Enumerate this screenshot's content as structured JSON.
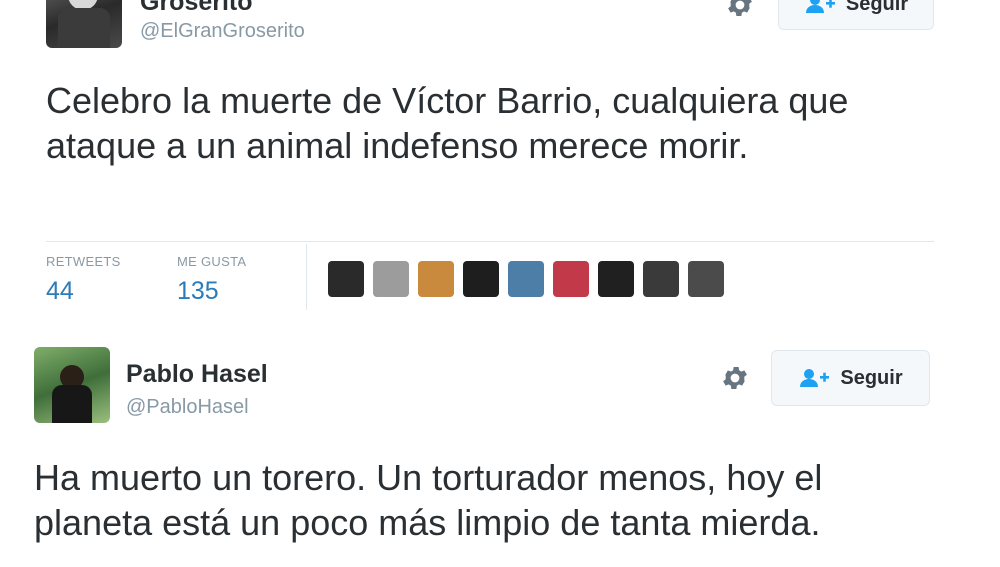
{
  "tweet1": {
    "name": "Groserito",
    "handle": "@ElGranGroserito",
    "follow_label": "Seguir",
    "text": "Celebro la muerte de Víctor Barrio, cualquiera que ataque a un animal indefenso merece morir.",
    "retweets_label": "RETWEETS",
    "retweets_count": "44",
    "likes_label": "ME GUSTA",
    "likes_count": "135",
    "liker_colors": [
      "#2a2a2a",
      "#9c9c9c",
      "#c98a3d",
      "#1e1e1e",
      "#4d7ea8",
      "#c23a4a",
      "#202020",
      "#3a3a3a",
      "#4b4b4b"
    ]
  },
  "tweet2": {
    "name": "Pablo Hasel",
    "handle": "@PabloHasel",
    "follow_label": "Seguir",
    "text": "Ha muerto un torero. Un torturador menos, hoy el planeta está un poco más limpio de tanta mierda."
  },
  "icons": {
    "gear": "gear-icon",
    "follow": "add-user-icon"
  },
  "colors": {
    "link": "#2b7bb9",
    "muted": "#8899a6",
    "button_bg": "#f5f8fa"
  }
}
